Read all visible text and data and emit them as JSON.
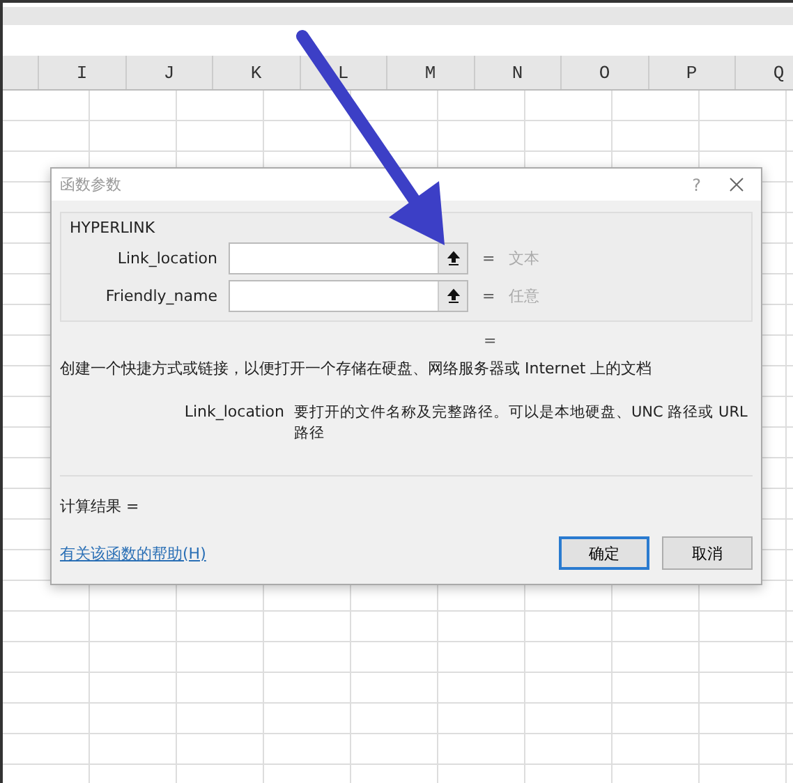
{
  "columns": [
    "I",
    "J",
    "K",
    "L",
    "M",
    "N",
    "O",
    "P",
    "Q"
  ],
  "dialog": {
    "title": "函数参数",
    "help_button": "?",
    "function_name": "HYPERLINK",
    "arguments": [
      {
        "label": "Link_location",
        "equals": "=",
        "result": "文本"
      },
      {
        "label": "Friendly_name",
        "equals": "=",
        "result": "任意"
      }
    ],
    "overall_result": "=",
    "description": "创建一个快捷方式或链接，以便打开一个存储在硬盘、网络服务器或 Internet 上的文档",
    "argument_help": {
      "name": "Link_location",
      "text": "要打开的文件名称及完整路径。可以是本地硬盘、UNC 路径或 URL 路径"
    },
    "formula_result": "计算结果 =",
    "help_link": "有关该函数的帮助(H)",
    "buttons": [
      {
        "label": "确定",
        "default": true
      },
      {
        "label": "取消",
        "default": false
      }
    ]
  }
}
